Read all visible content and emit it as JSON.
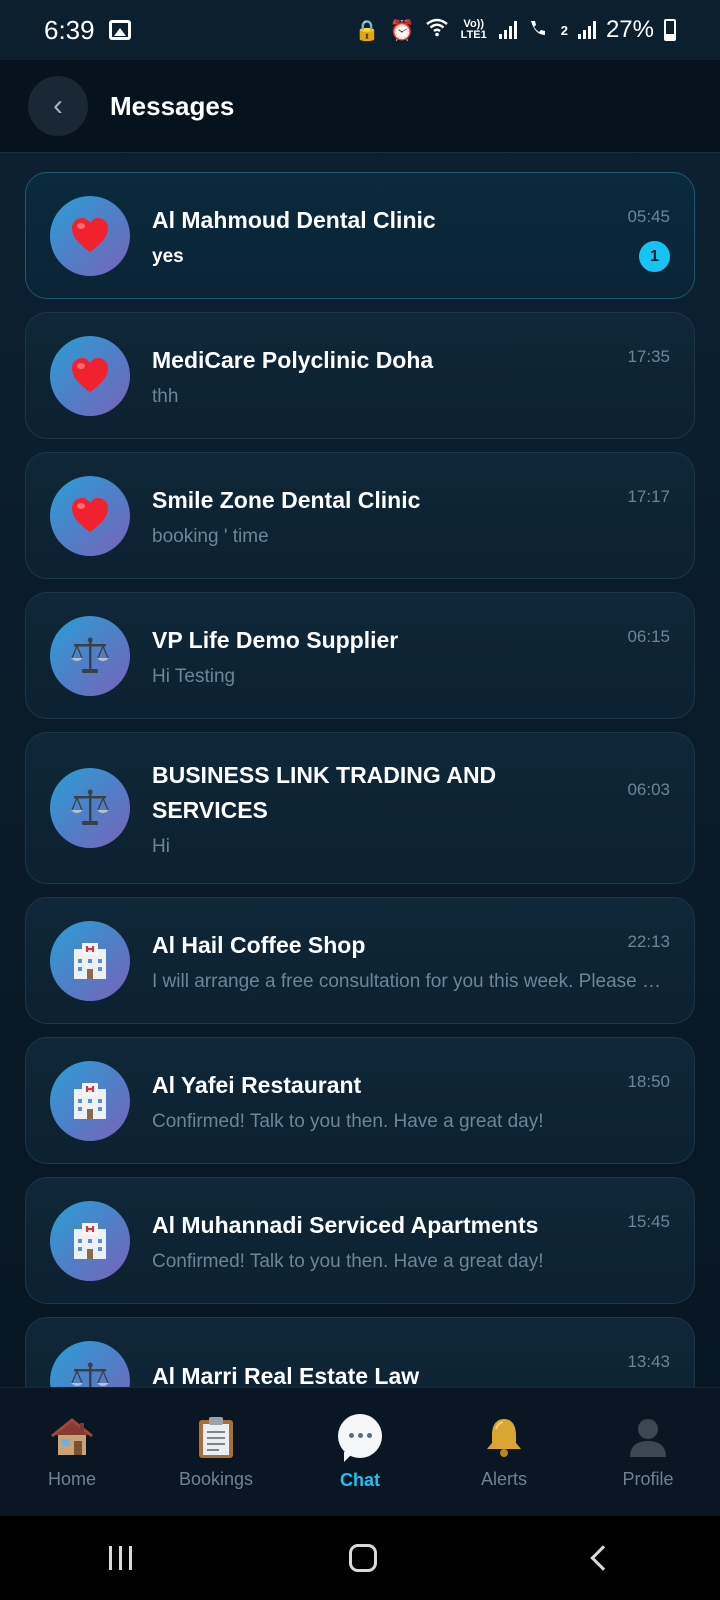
{
  "status_bar": {
    "time": "6:39",
    "network_label": "Vo)) LTE1",
    "sim2_label": "2",
    "battery": "27%"
  },
  "header": {
    "title": "Messages"
  },
  "chats": [
    {
      "name": "Al Mahmoud Dental Clinic",
      "preview": "yes",
      "time": "05:45",
      "unread": "1",
      "icon": "heart-icon"
    },
    {
      "name": "MediCare Polyclinic Doha",
      "preview": "thh",
      "time": "17:35",
      "icon": "heart-icon"
    },
    {
      "name": "Smile Zone Dental Clinic",
      "preview": "booking ' time",
      "time": "17:17",
      "icon": "heart-icon"
    },
    {
      "name": "VP Life Demo Supplier",
      "preview": "Hi Testing",
      "time": "06:15",
      "icon": "scales-icon"
    },
    {
      "name": "BUSINESS LINK TRADING AND SERVICES",
      "preview": "Hi",
      "time": "06:03",
      "icon": "scales-icon"
    },
    {
      "name": "Al Hail Coffee Shop",
      "preview": "I will arrange a free consultation for you this week. Please confirm",
      "time": "22:13",
      "icon": "hospital-icon"
    },
    {
      "name": "Al Yafei Restaurant",
      "preview": "Confirmed! Talk to you then. Have a great day!",
      "time": "18:50",
      "icon": "hospital-icon"
    },
    {
      "name": "Al Muhannadi Serviced Apartments",
      "preview": "Confirmed! Talk to you then. Have a great day!",
      "time": "15:45",
      "icon": "hospital-icon"
    },
    {
      "name": "Al Marri Real Estate Law",
      "preview": "",
      "time": "13:43",
      "icon": "scales-icon"
    }
  ],
  "nav": {
    "home": "Home",
    "bookings": "Bookings",
    "chat": "Chat",
    "alerts": "Alerts",
    "profile": "Profile"
  },
  "colors": {
    "accent": "#22c0ef",
    "badge": "#17c3f3",
    "background": "#0a1c2b"
  }
}
